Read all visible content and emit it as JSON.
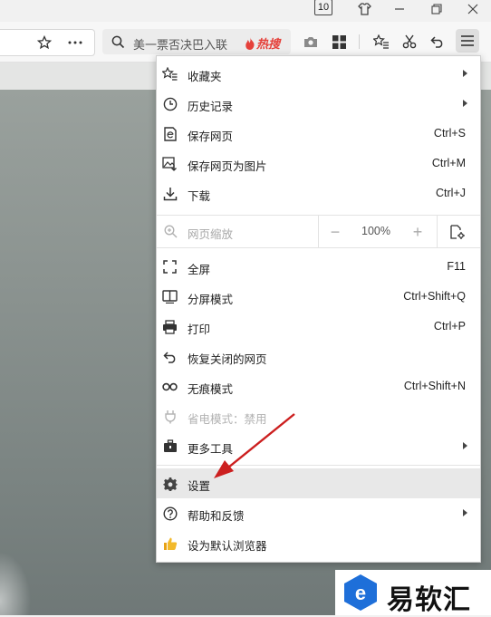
{
  "titlebar": {
    "tab_count": "10"
  },
  "search": {
    "text": "美一票否决巴入联",
    "hot_label": "热搜"
  },
  "menu": {
    "items_group1": [
      {
        "label": "收藏夹",
        "shortcut": "",
        "has_submenu": true,
        "icon": "star-list-icon"
      },
      {
        "label": "历史记录",
        "shortcut": "",
        "has_submenu": true,
        "icon": "clock-icon"
      },
      {
        "label": "保存网页",
        "shortcut": "Ctrl+S",
        "has_submenu": false,
        "icon": "save-page-icon"
      },
      {
        "label": "保存网页为图片",
        "shortcut": "Ctrl+M",
        "has_submenu": false,
        "icon": "save-image-icon"
      },
      {
        "label": "下载",
        "shortcut": "Ctrl+J",
        "has_submenu": false,
        "icon": "download-icon"
      }
    ],
    "zoom": {
      "label": "网页缩放",
      "value": "100%",
      "minus": "−",
      "plus": "+"
    },
    "items_group2": [
      {
        "label": "全屏",
        "shortcut": "F11",
        "icon": "fullscreen-icon"
      },
      {
        "label": "分屏模式",
        "shortcut": "Ctrl+Shift+Q",
        "icon": "split-screen-icon"
      },
      {
        "label": "打印",
        "shortcut": "Ctrl+P",
        "icon": "printer-icon"
      },
      {
        "label": "恢复关闭的网页",
        "shortcut": "",
        "icon": "undo-icon"
      },
      {
        "label": "无痕模式",
        "shortcut": "Ctrl+Shift+N",
        "icon": "incognito-icon"
      },
      {
        "label": "省电模式：禁用",
        "shortcut": "",
        "icon": "plug-icon",
        "disabled": true
      },
      {
        "label": "更多工具",
        "shortcut": "",
        "icon": "toolbox-icon",
        "has_submenu": true
      }
    ],
    "items_group3": [
      {
        "label": "设置",
        "icon": "gear-icon",
        "highlighted": true
      },
      {
        "label": "帮助和反馈",
        "icon": "help-icon",
        "has_submenu": true
      },
      {
        "label": "设为默认浏览器",
        "icon": "thumbs-up-icon"
      }
    ]
  },
  "watermark": {
    "text": "易软汇"
  },
  "colors": {
    "hot": "#e5403a",
    "arrow": "#cc1f1f",
    "logo": "#1e6fd9"
  }
}
